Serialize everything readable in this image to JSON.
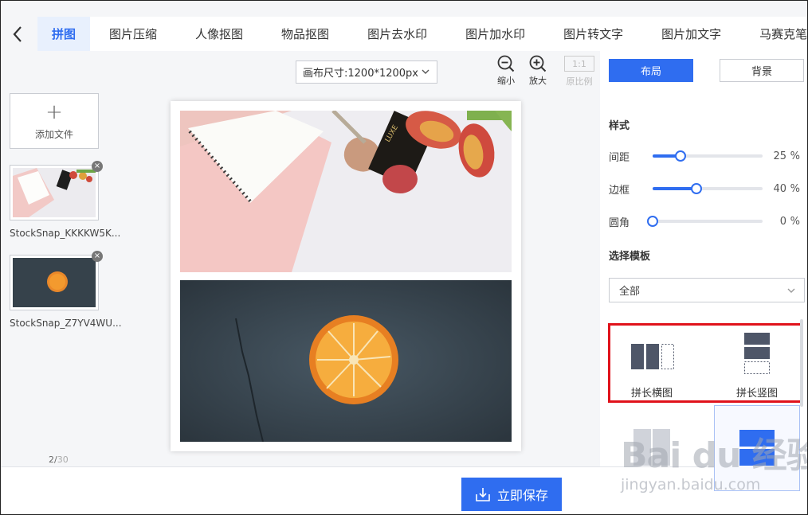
{
  "tabs": [
    {
      "label": "拼图",
      "active": true
    },
    {
      "label": "图片压缩"
    },
    {
      "label": "人像抠图"
    },
    {
      "label": "物品抠图"
    },
    {
      "label": "图片去水印"
    },
    {
      "label": "图片加水印"
    },
    {
      "label": "图片转文字"
    },
    {
      "label": "图片加文字"
    },
    {
      "label": "马赛克笔"
    }
  ],
  "left": {
    "add_file_label": "添加文件",
    "files": [
      {
        "name": "StockSnap_KKKKW5K..."
      },
      {
        "name": "StockSnap_Z7YV4WU..."
      }
    ],
    "count_current": "2/",
    "count_total": "30"
  },
  "toolbar": {
    "canvas_size": "画布尺寸:1200*1200px",
    "zoom_out_label": "缩小",
    "zoom_in_label": "放大",
    "ratio_box": "1:1",
    "ratio_label": "原比例"
  },
  "right": {
    "layout_tab": "布局",
    "background_tab": "背景",
    "style_title": "样式",
    "sliders": [
      {
        "label": "间距",
        "value": "25",
        "unit": "%",
        "level": 0.25
      },
      {
        "label": "边框",
        "value": "40",
        "unit": "%",
        "level": 0.4
      },
      {
        "label": "圆角",
        "value": "0",
        "unit": "%",
        "level": 0
      }
    ],
    "template_title": "选择模板",
    "template_filter": "全部",
    "templates": [
      {
        "label": "拼长横图"
      },
      {
        "label": "拼长竖图"
      }
    ]
  },
  "bottom": {
    "save_label": "立即保存"
  },
  "watermark": {
    "brand": "Bai du 经验",
    "url": "jingyan.baidu.com"
  },
  "colors": {
    "accent": "#2f6df0",
    "highlight_box": "#e0121b",
    "template_icon": "#4e5668"
  }
}
